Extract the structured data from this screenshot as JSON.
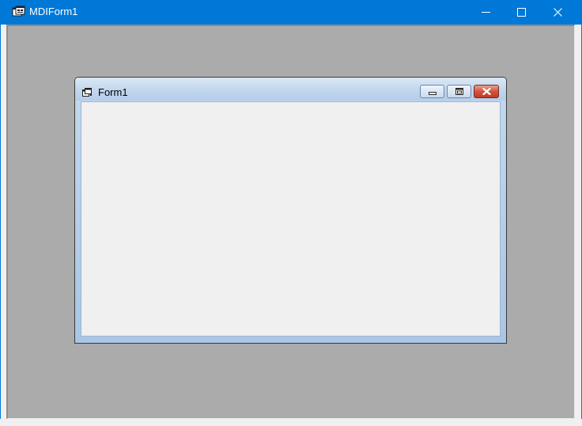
{
  "mdi_window": {
    "title": "MDIForm1",
    "icon": "vb-app-icon",
    "controls": {
      "minimize": "minimize-icon",
      "maximize": "maximize-icon",
      "close": "close-icon"
    },
    "colors": {
      "titlebar": "#0078d7",
      "client_background": "#ababab"
    }
  },
  "child_form": {
    "title": "Form1",
    "icon": "vb-form-icon",
    "controls": {
      "minimize": "minimize-icon",
      "restore": "maximize-icon",
      "close": "close-icon"
    },
    "colors": {
      "frame": "#b4cdea",
      "client_background": "#f0f0f0",
      "close_button": "#c23a22"
    }
  }
}
